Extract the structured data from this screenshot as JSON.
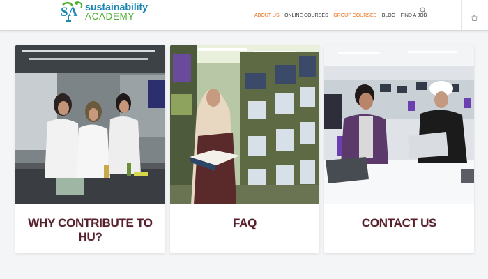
{
  "header": {
    "logo": {
      "mark_text": "SA",
      "line1": "sustainability",
      "line2": "ACADEMY"
    },
    "nav": [
      {
        "label": "ABOUT US",
        "color": "#e86d17"
      },
      {
        "label": "ONLINE COURSES",
        "color": "#333333"
      },
      {
        "label": "GROUP COURSES",
        "color": "#e86d17"
      },
      {
        "label": "BLOG",
        "color": "#333333"
      },
      {
        "label": "FIND A JOB",
        "color": "#333333"
      }
    ],
    "icons": [
      "search-icon",
      "cart-icon"
    ]
  },
  "cards": [
    {
      "title": "WHY CONTRIBUTE TO HU?",
      "image": "students in laboratory"
    },
    {
      "title": "FAQ",
      "image": "student reading in library"
    },
    {
      "title": "CONTACT US",
      "image": "students with laptops"
    }
  ],
  "colors": {
    "brand_blue": "#1d87b3",
    "brand_green": "#4caf2e",
    "nav_accent": "#e86d17",
    "card_title": "#5a1f2d"
  }
}
